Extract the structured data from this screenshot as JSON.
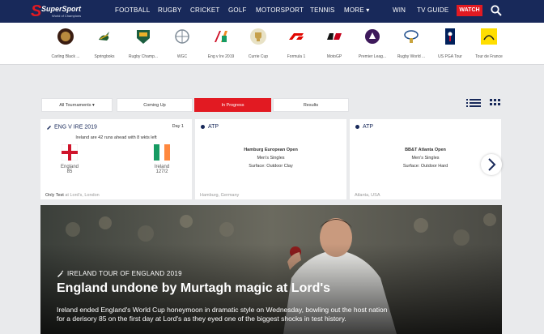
{
  "brand": {
    "name": "SuperSport",
    "tagline": "World of Champions",
    "accent": "#e21a22",
    "navy": "#18295a"
  },
  "nav": {
    "links": [
      "FOOTBALL",
      "RUGBY",
      "CRICKET",
      "GOLF",
      "MOTORSPORT",
      "TENNIS",
      "MORE ▾"
    ],
    "win": "WIN",
    "tv_guide": "TV GUIDE",
    "watch": "WATCH"
  },
  "sports": [
    {
      "label": "Carling Black ...",
      "icon": "carling-black-label-icon"
    },
    {
      "label": "Springboks",
      "icon": "springbok-icon"
    },
    {
      "label": "Rugby Champ...",
      "icon": "rugby-championship-icon"
    },
    {
      "label": "WGC",
      "icon": "wgc-icon"
    },
    {
      "label": "Eng v Ire 2019",
      "icon": "england-ireland-icon"
    },
    {
      "label": "Currie Cup",
      "icon": "currie-cup-icon"
    },
    {
      "label": "Formula 1",
      "icon": "formula-1-icon"
    },
    {
      "label": "MotoGP",
      "icon": "motogp-icon"
    },
    {
      "label": "Premier Leag...",
      "icon": "premier-league-icon"
    },
    {
      "label": "Rugby World ...",
      "icon": "rugby-world-cup-icon"
    },
    {
      "label": "US PGA Tour",
      "icon": "pga-tour-icon"
    },
    {
      "label": "Tour de France",
      "icon": "tour-de-france-icon"
    }
  ],
  "filters": {
    "all": "All Tournaments ▾",
    "coming_up": "Coming Up",
    "in_progress": "In Progress",
    "results": "Results"
  },
  "cards": {
    "cricket": {
      "title": "ENG V IRE 2019",
      "day": "Day 1",
      "status": "Ireland are 42 runs ahead with 8 wkts left",
      "team1": {
        "name": "England",
        "score": "85"
      },
      "team2": {
        "name": "Ireland",
        "score": "127/2"
      },
      "foot_bold": "Only Test",
      "foot_rest": " at Lord's, London"
    },
    "atp1": {
      "title": "ATP",
      "event": "Hamburg European Open",
      "draw": "Men's Singles",
      "surface": "Surface: Outdoor Clay",
      "location": "Hamburg, Germany"
    },
    "atp2": {
      "title": "ATP",
      "event": "BB&T Atlanta Open",
      "draw": "Men's Singles",
      "surface": "Surface: Outdoor Hard",
      "location": "Atlanta, USA"
    }
  },
  "hero": {
    "tag": "IRELAND TOUR OF ENGLAND 2019",
    "title": "England undone by Murtagh magic at Lord's",
    "description": "Ireland ended England's World Cup honeymoon in dramatic style on Wednesday, bowling out the host nation for a derisory 85 on the first day at Lord's as they eyed one of the biggest shocks in test history."
  }
}
